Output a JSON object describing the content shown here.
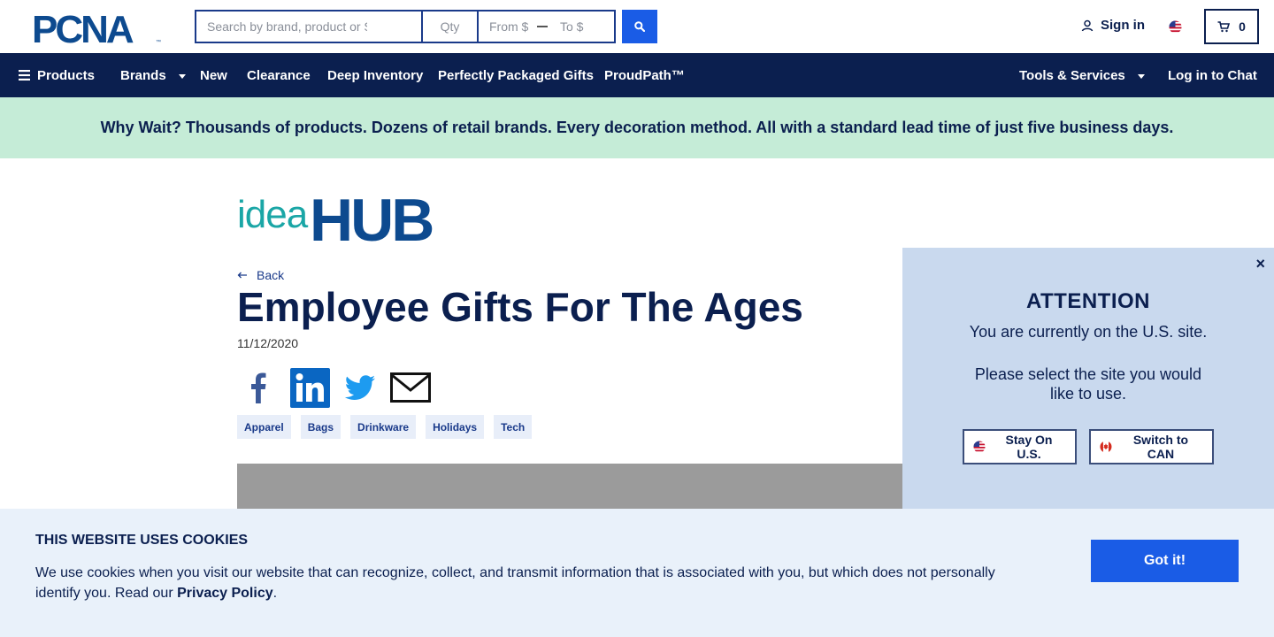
{
  "brand": {
    "logo_text": "PCNA",
    "trademark": "™"
  },
  "search": {
    "main_placeholder": "Search by brand, product or SKU",
    "qty_placeholder": "Qty",
    "from_placeholder": "From $",
    "to_placeholder": "To $"
  },
  "header": {
    "signin_label": "Sign in",
    "cart_count": "0"
  },
  "nav": {
    "products": "Products",
    "brands": "Brands",
    "new": "New",
    "clearance": "Clearance",
    "deep_inventory": "Deep Inventory",
    "gifts": "Perfectly Packaged Gifts",
    "proudpath": "ProudPath™",
    "tools": "Tools & Services",
    "chat": "Log in to Chat"
  },
  "promo": {
    "text": "Why Wait? Thousands of products. Dozens of retail brands. Every decoration method. All with a standard lead time of just five business days."
  },
  "article": {
    "logo_idea": "idea",
    "logo_hub": "HUB",
    "back_label": "Back",
    "title": "Employee Gifts For The Ages",
    "date": "11/12/2020",
    "tags": [
      "Apparel",
      "Bags",
      "Drinkware",
      "Holidays",
      "Tech"
    ]
  },
  "attention": {
    "close": "×",
    "title": "ATTENTION",
    "message": "You are currently on the U.S. site.",
    "prompt": "Please select the site you would like to use.",
    "stay_label": "Stay On U.S.",
    "switch_label": "Switch to CAN"
  },
  "cookie": {
    "title": "THIS WEBSITE USES COOKIES",
    "text": "We use cookies when you visit our website that can recognize, collect, and transmit information that is associated with you, but which does not personally identify you. Read our ",
    "link": "Privacy Policy",
    "end": ".",
    "button": "Got it!"
  },
  "colors": {
    "navy": "#0b1f4f",
    "accent_blue": "#1a5ce6",
    "promo_green": "#c5ecd7",
    "teal": "#1aa6a6",
    "hub_blue": "#0d4a8f"
  }
}
